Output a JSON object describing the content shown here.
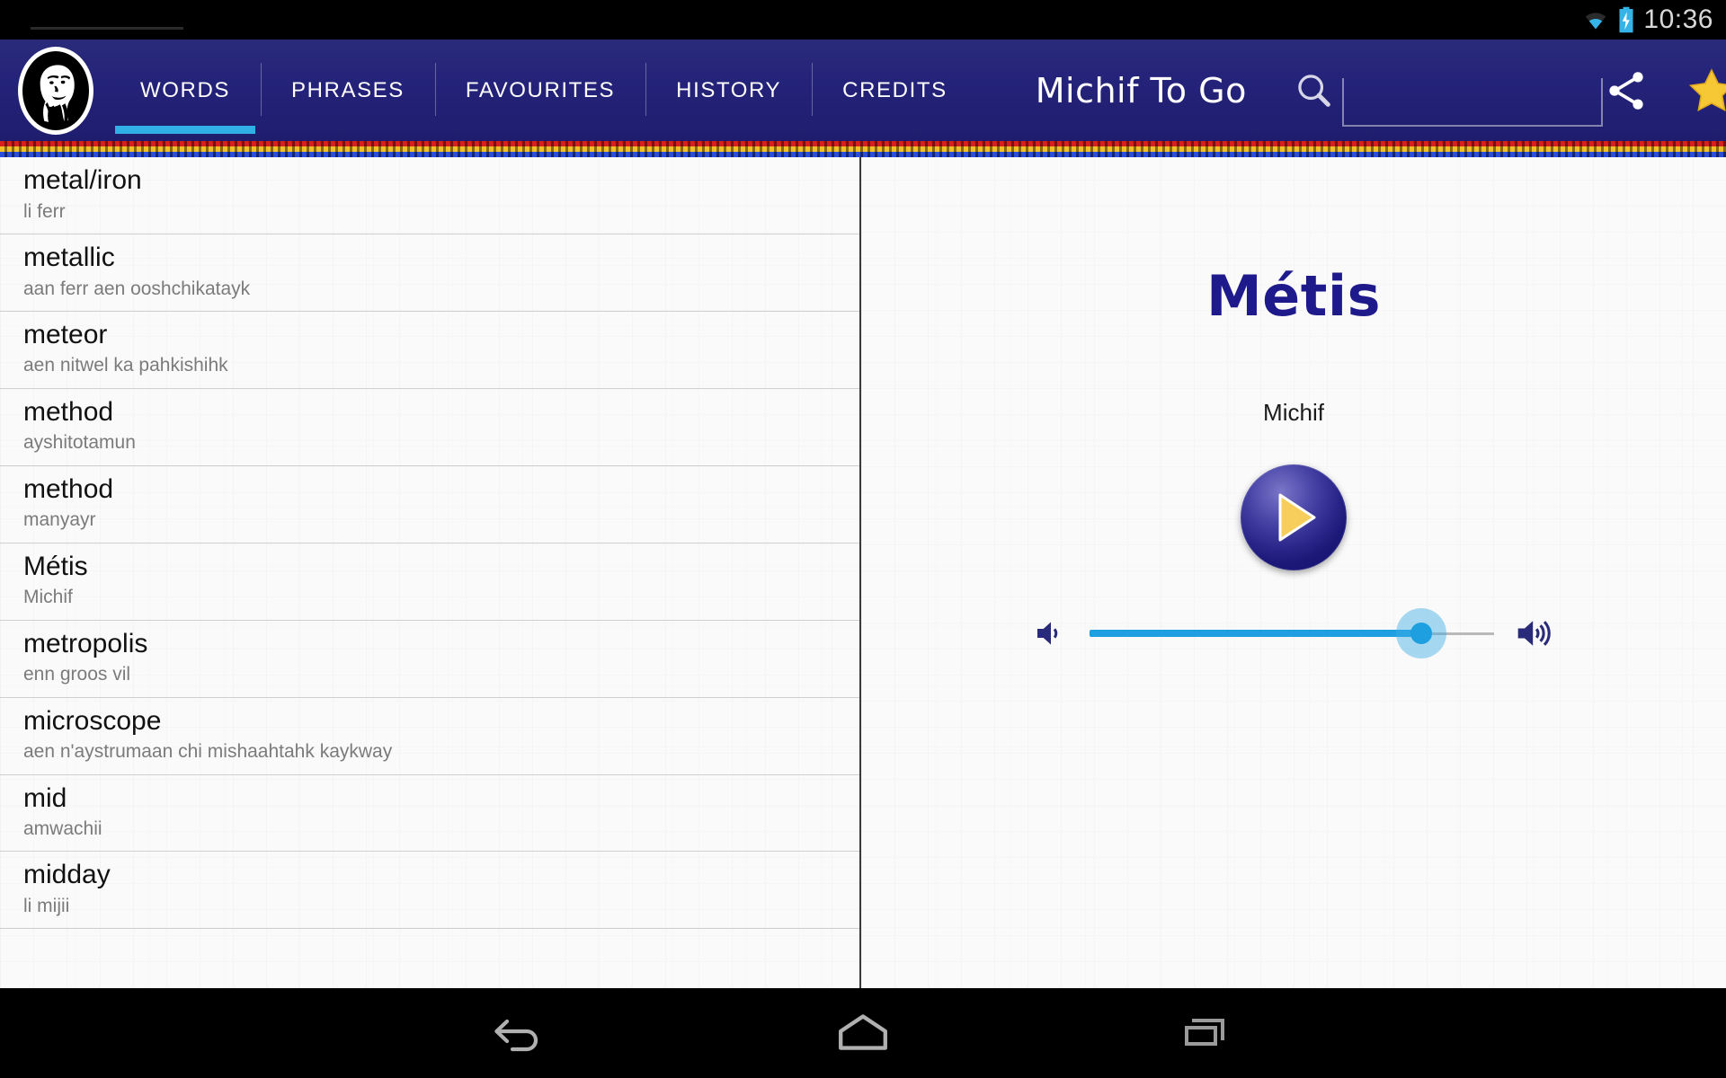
{
  "status_bar": {
    "time": "10:36",
    "icons": [
      "wifi-icon",
      "battery-charging-icon"
    ]
  },
  "header": {
    "logo_name": "metis-portrait-logo",
    "app_title": "Michif To Go",
    "tabs": [
      {
        "label": "WORDS",
        "active": true
      },
      {
        "label": "PHRASES",
        "active": false
      },
      {
        "label": "FAVOURITES",
        "active": false
      },
      {
        "label": "HISTORY",
        "active": false
      },
      {
        "label": "CREDITS",
        "active": false
      }
    ],
    "search": {
      "value": "",
      "placeholder": ""
    },
    "actions": [
      {
        "name": "share-icon"
      },
      {
        "name": "favourite-star-icon"
      }
    ],
    "accent_color": "#31b0e8",
    "bar_color": "#24237a"
  },
  "word_list": [
    {
      "english": "metal/iron",
      "michif": "li ferr"
    },
    {
      "english": "metallic",
      "michif": "aan ferr aen ooshchikatayk"
    },
    {
      "english": "meteor",
      "michif": "aen nitwel ka pahkishihk"
    },
    {
      "english": "method",
      "michif": "ayshitotamun"
    },
    {
      "english": "method",
      "michif": "manyayr"
    },
    {
      "english": "Métis",
      "michif": "Michif"
    },
    {
      "english": "metropolis",
      "michif": "enn groos vil"
    },
    {
      "english": "microscope",
      "michif": "aen n'aystrumaan chi mishaahtahk kaykway"
    },
    {
      "english": "mid",
      "michif": "amwachii"
    },
    {
      "english": "midday",
      "michif": "li mijii"
    }
  ],
  "detail": {
    "title": "Métis",
    "title_color": "#1e1a8c",
    "translation": "Michif",
    "play_button_name": "play-audio-button",
    "volume": {
      "value_percent": 82,
      "min_icon": "volume-low-icon",
      "max_icon": "volume-high-icon",
      "track_color": "#1d9fe0"
    }
  },
  "nav_bar": {
    "buttons": [
      {
        "name": "back-icon"
      },
      {
        "name": "home-icon"
      },
      {
        "name": "recents-icon"
      }
    ]
  }
}
